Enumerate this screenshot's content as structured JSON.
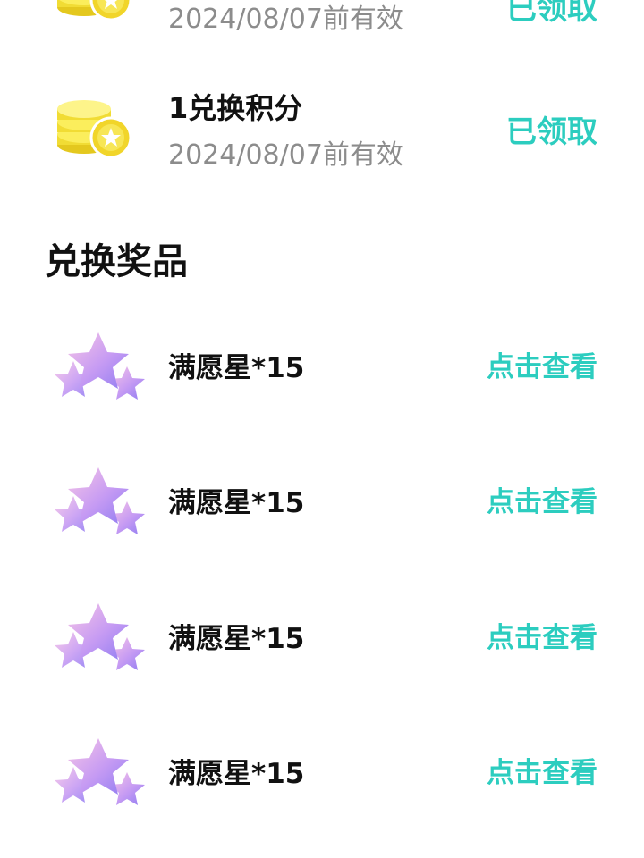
{
  "points": [
    {
      "title": "",
      "date": "2024/08/07前有效",
      "status": "已领取"
    },
    {
      "title": "1兑换积分",
      "date": "2024/08/07前有效",
      "status": "已领取"
    }
  ],
  "section": {
    "title": "兑换奖品"
  },
  "prizes": [
    {
      "name": "满愿星*15",
      "action": "点击查看"
    },
    {
      "name": "满愿星*15",
      "action": "点击查看"
    },
    {
      "name": "满愿星*15",
      "action": "点击查看"
    },
    {
      "name": "满愿星*15",
      "action": "点击查看"
    }
  ],
  "colors": {
    "accent": "#2ccdbf",
    "coin": "#f5e23a",
    "star": "#b98af0"
  }
}
